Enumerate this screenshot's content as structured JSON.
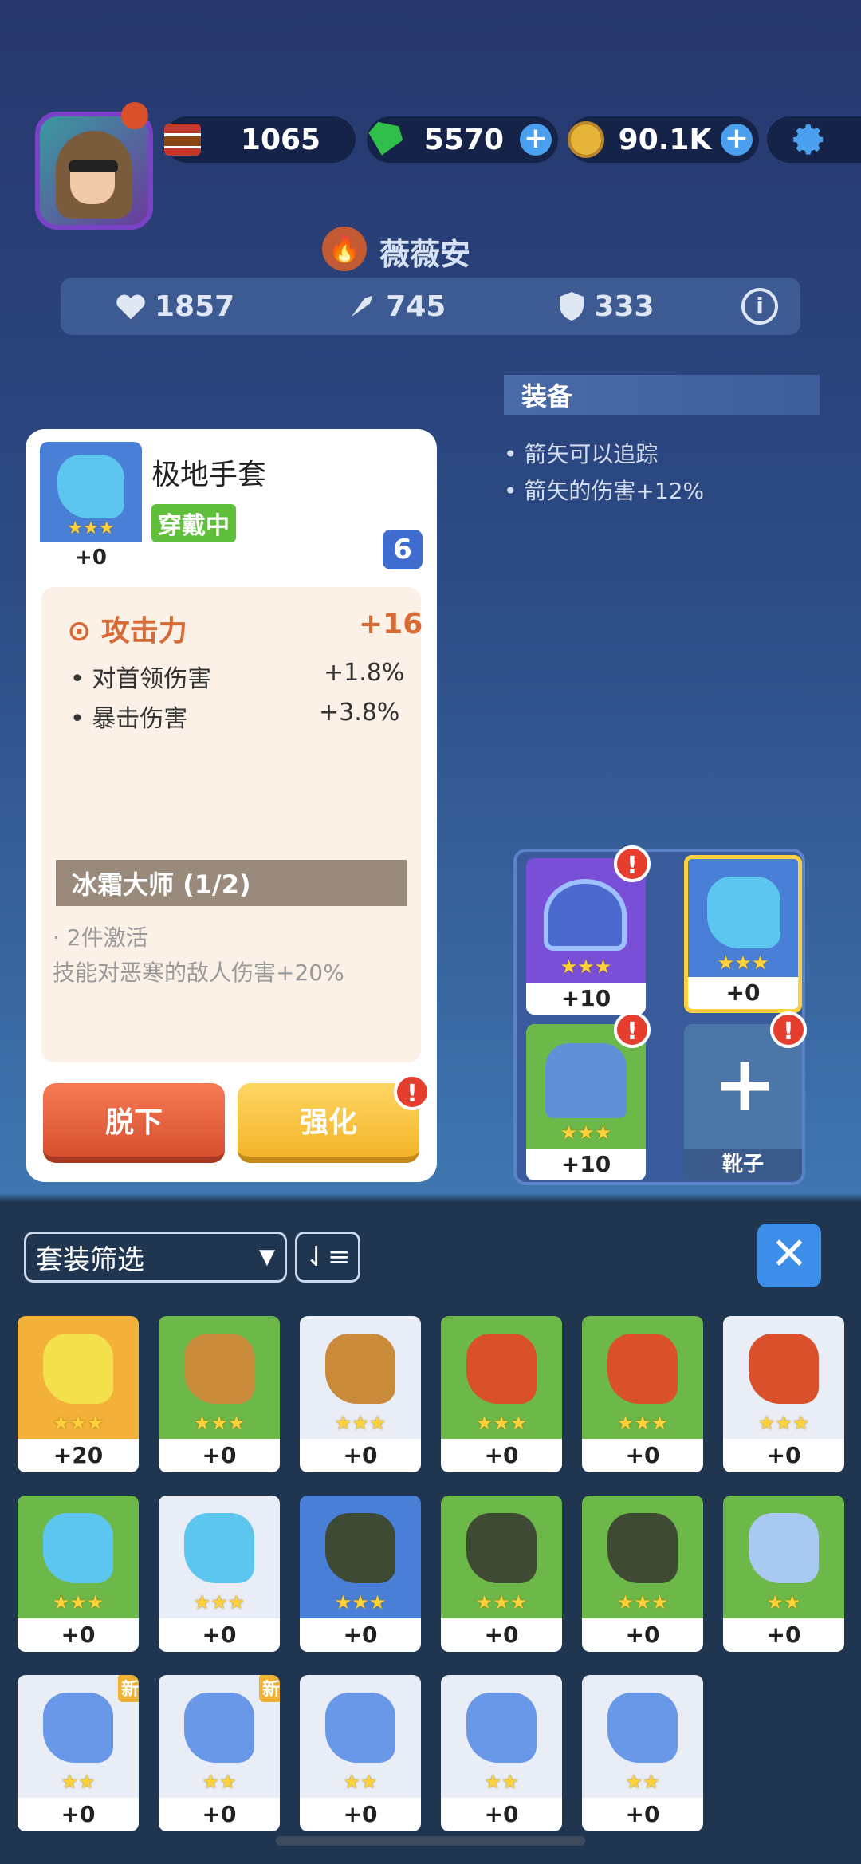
{
  "resources": {
    "cake": "1065",
    "gems": "5570",
    "coins": "90.1K"
  },
  "player": {
    "name": "薇薇安"
  },
  "stats": {
    "hp": "1857",
    "attack": "745",
    "defense": "333"
  },
  "equip_panel": {
    "title": "装备",
    "lines": [
      "• 箭矢可以追踪",
      "• 箭矢的伤害+12%"
    ]
  },
  "item": {
    "name": "极地手套",
    "status": "穿戴中",
    "level": "6",
    "enhance": "+0",
    "main_attr": {
      "label": "攻击力",
      "value": "+16"
    },
    "sub_attrs": [
      {
        "label": "• 对首领伤害",
        "value": "+1.8%"
      },
      {
        "label": "• 暴击伤害",
        "value": "+3.8%"
      }
    ],
    "set": {
      "name": "冰霜大师 (1/2)",
      "line1": "· 2件激活",
      "line2": "技能对恶寒的敌人伤害+20%"
    },
    "btn_remove": "脱下",
    "btn_upgrade": "强化"
  },
  "slots": [
    {
      "label": "+10",
      "color": "#7a4fd8"
    },
    {
      "label": "+0",
      "color": "#4a7fd8"
    },
    {
      "label": "+10",
      "color": "#6cb94a"
    },
    {
      "label": "靴子"
    }
  ],
  "filter": {
    "label": "套装筛选"
  },
  "inventory": [
    {
      "label": "+20",
      "bg": "#f3b13a",
      "item": "#f2e14a",
      "stars": "★★★"
    },
    {
      "label": "+0",
      "bg": "#6cb94a",
      "item": "#c98a3a",
      "stars": "★★★"
    },
    {
      "label": "+0",
      "bg": "#e9edf5",
      "item": "#c98a3a",
      "stars": "★★★"
    },
    {
      "label": "+0",
      "bg": "#6cb94a",
      "item": "#d9502a",
      "stars": "★★★"
    },
    {
      "label": "+0",
      "bg": "#6cb94a",
      "item": "#d9502a",
      "stars": "★★★"
    },
    {
      "label": "+0",
      "bg": "#e9edf5",
      "item": "#d9502a",
      "stars": "★★★"
    },
    {
      "label": "+0",
      "bg": "#6cb94a",
      "item": "#5cc6ee",
      "stars": "★★★"
    },
    {
      "label": "+0",
      "bg": "#e9edf5",
      "item": "#5cc6ee",
      "stars": "★★★"
    },
    {
      "label": "+0",
      "bg": "#4a7fd8",
      "item": "#3f4a34",
      "stars": "★★★"
    },
    {
      "label": "+0",
      "bg": "#6cb94a",
      "item": "#3f4a34",
      "stars": "★★★"
    },
    {
      "label": "+0",
      "bg": "#6cb94a",
      "item": "#3f4a34",
      "stars": "★★★"
    },
    {
      "label": "+0",
      "bg": "#6cb94a",
      "item": "#a9c8f2",
      "stars": "★★"
    },
    {
      "label": "+0",
      "bg": "#e9edf5",
      "item": "#6a98e8",
      "stars": "★★",
      "new": "新"
    },
    {
      "label": "+0",
      "bg": "#e9edf5",
      "item": "#6a98e8",
      "stars": "★★",
      "new": "新"
    },
    {
      "label": "+0",
      "bg": "#e9edf5",
      "item": "#6a98e8",
      "stars": "★★"
    },
    {
      "label": "+0",
      "bg": "#e9edf5",
      "item": "#6a98e8",
      "stars": "★★"
    },
    {
      "label": "+0",
      "bg": "#e9edf5",
      "item": "#6a98e8",
      "stars": "★★"
    }
  ]
}
